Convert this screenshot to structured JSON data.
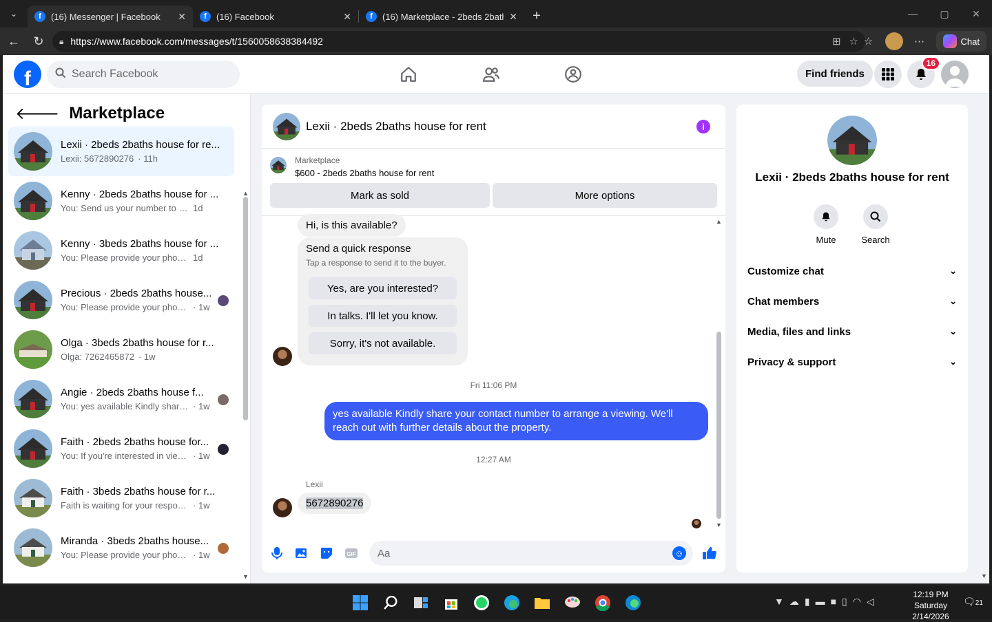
{
  "browser": {
    "tabs": [
      {
        "title": "(16) Messenger | Facebook",
        "active": true
      },
      {
        "title": "(16) Facebook",
        "active": false
      },
      {
        "title": "(16) Marketplace - 2beds 2baths h",
        "active": false
      }
    ],
    "url": "https://www.facebook.com/messages/t/1560058638384492",
    "copilot_label": "Chat"
  },
  "fb": {
    "search_placeholder": "Search Facebook",
    "find_friends": "Find friends",
    "notif_count": "16"
  },
  "sidebar": {
    "title": "Marketplace",
    "conversations": [
      {
        "title": "Lexii · 2beds 2baths house for re...",
        "preview": "Lexii: 5672890276",
        "time": "· 11h",
        "img": "house-dark"
      },
      {
        "title": "Kenny · 2beds 2baths house for ...",
        "preview": "You: Send us your number to book ...",
        "time": "1d",
        "img": "house-dark"
      },
      {
        "title": "Kenny · 3beds 2baths house for ...",
        "preview": "You: Please provide your phone nu...",
        "time": "1d",
        "img": "house-blue"
      },
      {
        "title": "Precious · 2beds 2baths house...",
        "preview": "You: Please provide your phone ...",
        "time": "· 1w",
        "img": "house-dark"
      },
      {
        "title": "Olga · 3beds 2baths house for r...",
        "preview": "Olga: 7262465872",
        "time": "· 1w",
        "img": "house-green"
      },
      {
        "title": "Angie · 2beds 2baths house f...",
        "preview": "You: yes available Kindly share y...",
        "time": "· 1w",
        "img": "house-dark"
      },
      {
        "title": "Faith · 2beds 2baths house for...",
        "preview": "You: If you're interested in viewi...",
        "time": "· 1w",
        "img": "house-dark"
      },
      {
        "title": "Faith · 3beds 2baths house for r...",
        "preview": "Faith is waiting for your response.",
        "time": "· 1w",
        "img": "house-white"
      },
      {
        "title": "Miranda · 3beds 2baths house...",
        "preview": "You: Please provide your phone ...",
        "time": "· 1w",
        "img": "house-white"
      }
    ]
  },
  "chat": {
    "title": "Lexii · 2beds 2baths house for rent",
    "marketplace_label": "Marketplace",
    "listing": "$600 - 2beds 2baths house for rent",
    "mark_sold": "Mark as sold",
    "more_options": "More options",
    "first_msg": "Hi, is this available?",
    "quick_title": "Send a quick response",
    "quick_sub": "Tap a response to send it to the buyer.",
    "quick_options": [
      "Yes, are you interested?",
      "In talks. I'll let you know.",
      "Sorry, it's not available."
    ],
    "ts1": "Fri 11:06 PM",
    "out_msg": "yes available Kindly share your contact number to arrange a viewing. We'll reach out with further details about the property.",
    "ts2": "12:27 AM",
    "sender": "Lexii",
    "phone": "5672890276",
    "input_placeholder": "Aa"
  },
  "details": {
    "name": "Lexii · 2beds 2baths house for rent",
    "mute": "Mute",
    "search": "Search",
    "sections": [
      "Customize chat",
      "Chat members",
      "Media, files and links",
      "Privacy & support"
    ]
  },
  "taskbar": {
    "time": "12:19 PM",
    "day": "Saturday",
    "date": "2/14/2026",
    "notif": "21"
  }
}
